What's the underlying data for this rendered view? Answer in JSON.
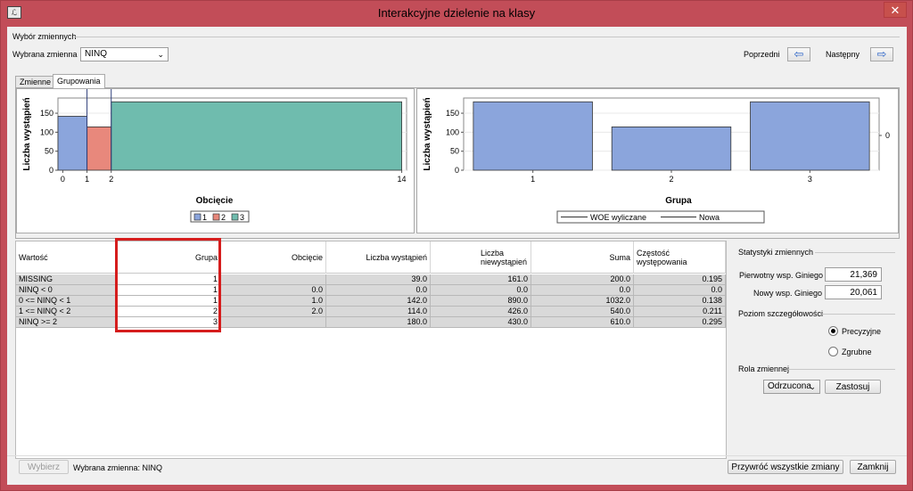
{
  "window": {
    "title": "Interakcyjne dzielenie na klasy",
    "close_glyph": "✕"
  },
  "variable_select": {
    "section_label": "Wybór zmiennych",
    "selected_label": "Wybrana zmienna",
    "selected_value": "NINQ",
    "prev_label": "Poprzedni",
    "next_label": "Następny"
  },
  "tabs": [
    {
      "label": "Zmienne",
      "active": false
    },
    {
      "label": "Grupowania",
      "active": true
    }
  ],
  "left_chart": {
    "ylabel": "Liczba wystąpień",
    "xlabel": "Obcięcie",
    "legend": [
      "1",
      "2",
      "3"
    ],
    "colors": [
      "#8ba5dc",
      "#e8887c",
      "#6fbcae"
    ]
  },
  "right_chart": {
    "ylabel": "Liczba wystąpień",
    "xlabel": "Grupa",
    "legend": [
      "WOE wyliczane",
      "Nowa"
    ],
    "right_tick": "0"
  },
  "chart_data": [
    {
      "type": "bar",
      "title": "",
      "xlabel": "Obcięcie",
      "ylabel": "Liczba wystąpień",
      "x_ticks": [
        "0",
        "1",
        "2",
        "14"
      ],
      "y_ticks": [
        "0",
        "50",
        "100",
        "150"
      ],
      "ylim": [
        0,
        190
      ],
      "xlim": [
        -0.2,
        14.2
      ],
      "legend_position": "bottom",
      "series": [
        {
          "name": "1",
          "x0": -0.2,
          "x1": 1,
          "value": 142
        },
        {
          "name": "2",
          "x0": 1,
          "x1": 2,
          "value": 114
        },
        {
          "name": "3",
          "x0": 2,
          "x1": 14,
          "value": 180
        }
      ],
      "grid": true
    },
    {
      "type": "bar",
      "title": "",
      "xlabel": "Grupa",
      "ylabel": "Liczba wystąpień",
      "categories": [
        "1",
        "2",
        "3"
      ],
      "values": [
        180,
        114,
        180
      ],
      "y_ticks": [
        "0",
        "50",
        "100",
        "150"
      ],
      "ylim": [
        0,
        190
      ],
      "legend_position": "bottom",
      "grid": true
    }
  ],
  "table": {
    "headers": [
      "Wartość",
      "Grupa",
      "Obcięcie",
      "Liczba wystąpień",
      "Liczba niewystąpień",
      "Suma",
      "Częstość występowania"
    ],
    "rows": [
      [
        "MISSING",
        "1",
        "",
        "39.0",
        "161.0",
        "200.0",
        "0.195"
      ],
      [
        "NINQ < 0",
        "1",
        "0.0",
        "0.0",
        "0.0",
        "0.0",
        "0.0"
      ],
      [
        "0 <= NINQ < 1",
        "1",
        "1.0",
        "142.0",
        "890.0",
        "1032.0",
        "0.138"
      ],
      [
        "1 <= NINQ < 2",
        "2",
        "2.0",
        "114.0",
        "426.0",
        "540.0",
        "0.211"
      ],
      [
        "NINQ >= 2",
        "3",
        "",
        "180.0",
        "430.0",
        "610.0",
        "0.295"
      ]
    ]
  },
  "stats": {
    "section_label": "Statystyki zmiennych",
    "orig_gini_label": "Pierwotny wsp. Giniego",
    "orig_gini_value": "21,369",
    "new_gini_label": "Nowy wsp. Giniego",
    "new_gini_value": "20,061",
    "detail_label": "Poziom szczegółowości",
    "precise_label": "Precyzyjne",
    "coarse_label": "Zgrubne",
    "role_label": "Rola zmiennej",
    "role_value": "Odrzucona",
    "apply_label": "Zastosuj"
  },
  "footer": {
    "choose_label": "Wybierz",
    "selected_text": "Wybrana zmienna:  NINQ",
    "restore_label": "Przywróć wszystkie zmiany",
    "close_label": "Zamknij"
  }
}
